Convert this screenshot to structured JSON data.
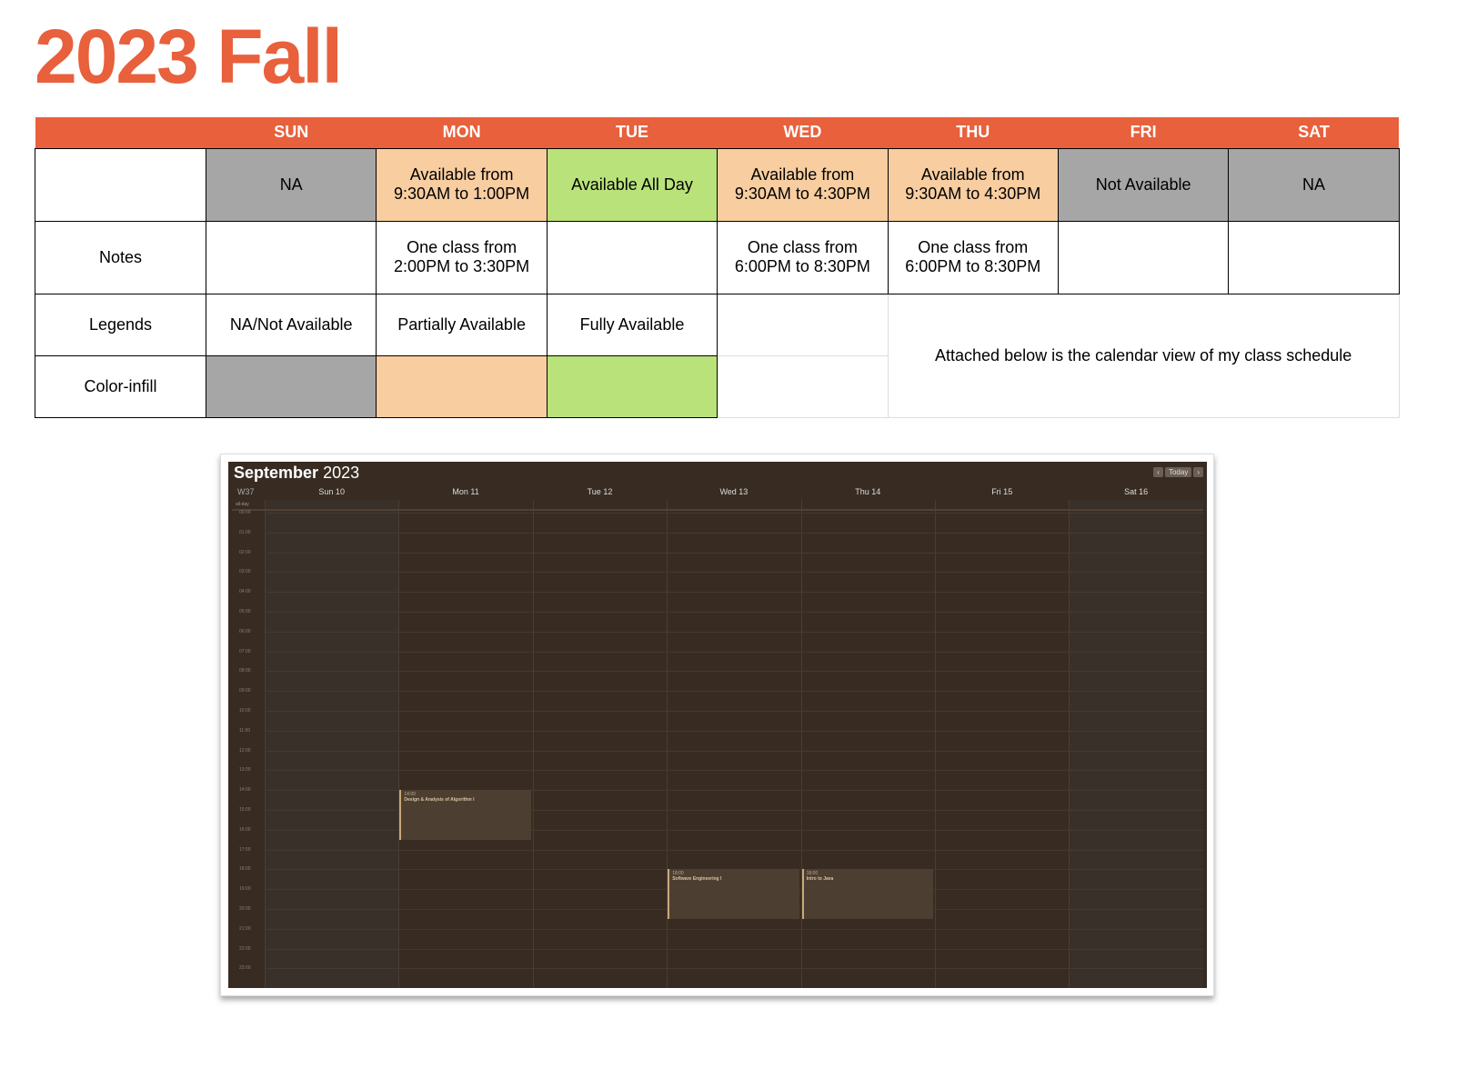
{
  "title": "2023 Fall",
  "days": [
    "SUN",
    "MON",
    "TUE",
    "WED",
    "THU",
    "FRI",
    "SAT"
  ],
  "availability": [
    "NA",
    "Available from 9:30AM to 1:00PM",
    "Available All Day",
    "Available from 9:30AM to 4:30PM",
    "Available from 9:30AM to 4:30PM",
    "Not Available",
    "NA"
  ],
  "notes_label": "Notes",
  "notes": [
    "",
    "One class from 2:00PM to 3:30PM",
    "",
    "One class from 6:00PM to 8:30PM",
    "One class from 6:00PM to 8:30PM",
    "",
    ""
  ],
  "legends_label": "Legends",
  "legends": [
    "NA/Not Available",
    "Partially Available",
    "Fully Available"
  ],
  "infill_label": "Color-infill",
  "attached_note": "Attached below is the calendar view of my class schedule",
  "colors": {
    "na": "#a6a6a6",
    "partial": "#f8cda0",
    "full": "#b9e27a",
    "accent": "#e8603c"
  },
  "calendar": {
    "month": "September",
    "year": "2023",
    "week": "W37",
    "today": "Today",
    "all_day": "all-day",
    "day_headers": [
      "Sun 10",
      "Mon 11",
      "Tue 12",
      "Wed 13",
      "Thu 14",
      "Fri 15",
      "Sat 16"
    ],
    "hours": [
      "00:00",
      "01:00",
      "02:00",
      "03:00",
      "04:00",
      "05:00",
      "06:00",
      "07:00",
      "08:00",
      "09:00",
      "10:00",
      "11:00",
      "12:00",
      "13:00",
      "14:00",
      "15:00",
      "16:00",
      "17:00",
      "18:00",
      "19:00",
      "20:00",
      "21:00",
      "22:00",
      "23:00"
    ],
    "events": [
      {
        "day": 1,
        "start": 14,
        "end": 16.5,
        "time": "14:00",
        "name": "Design & Analysis of Algorithm I"
      },
      {
        "day": 3,
        "start": 18,
        "end": 20.5,
        "time": "18:00",
        "name": "Software Engineering I"
      },
      {
        "day": 4,
        "start": 18,
        "end": 20.5,
        "time": "18:00",
        "name": "Intro to Java"
      }
    ]
  }
}
